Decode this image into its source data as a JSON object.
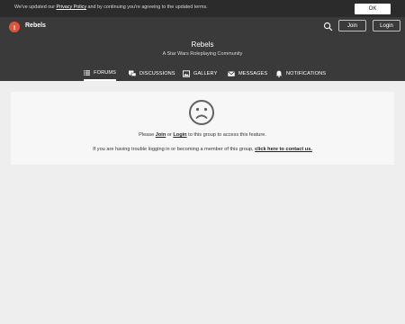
{
  "cookie": {
    "prefix": "We've updated our ",
    "policy_link": "Privacy Policy",
    "suffix": " and by continuing you're agreeing to the updated terms.",
    "ok_label": "OK"
  },
  "topbar": {
    "logo_glyph": "t",
    "title": "Rebels",
    "join_label": "Join",
    "login_label": "Login"
  },
  "group": {
    "title": "Rebels",
    "subtitle": "A Star Wars Roleplaying Community"
  },
  "nav": {
    "forums": "FORUMS",
    "discussions": "DISCUSSIONS",
    "gallery": "GALLERY",
    "messages": "MESSAGES",
    "notifications": "NOTIFICATIONS"
  },
  "notice": {
    "line1_prefix": "Please ",
    "join_link": "Join",
    "line1_or": " or ",
    "login_link": "Login",
    "line1_suffix": " to this group to access this feature.",
    "line2_prefix": "If you are having trouble logging in or becoming a member of this group, ",
    "contact_link": "click here to contact us."
  },
  "colors": {
    "header_bg": "#3a3a3a",
    "cookie_bg": "#2b2b2b",
    "logo_accent": "#e0533c",
    "page_bg": "#eeeeee"
  }
}
